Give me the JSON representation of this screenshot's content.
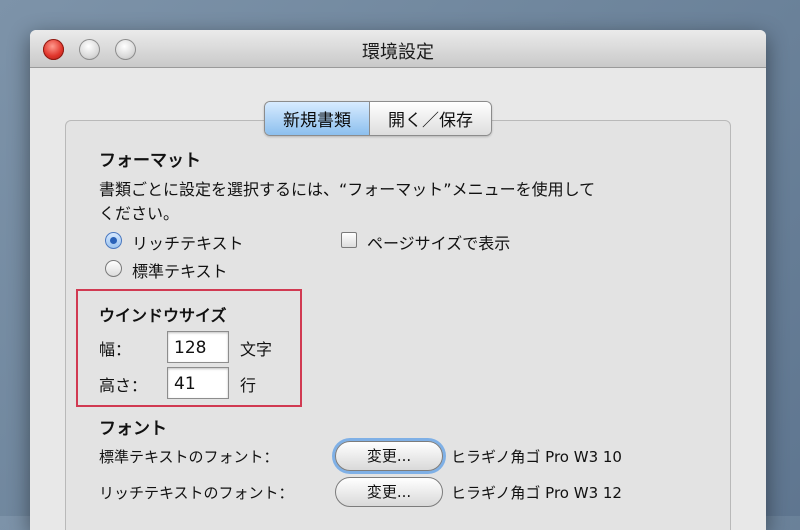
{
  "window": {
    "title": "環境設定"
  },
  "tabs": [
    {
      "label": "新規書類",
      "active": true
    },
    {
      "label": "開く／保存",
      "active": false
    }
  ],
  "format": {
    "heading": "フォーマット",
    "description_line1": "書類ごとに設定を選択するには、“フォーマット”メニューを使用して",
    "description_line2": "ください。",
    "rich_text_label": "リッチテキスト",
    "plain_text_label": "標準テキスト",
    "selected": "リッチテキスト",
    "show_page_size_label": "ページサイズで表示",
    "show_page_size_checked": false
  },
  "window_size": {
    "heading": "ウインドウサイズ",
    "width_label": "幅：",
    "width_value": "128",
    "width_unit": "文字",
    "height_label": "高さ：",
    "height_value": "41",
    "height_unit": "行"
  },
  "font": {
    "heading": "フォント",
    "plain_label": "標準テキストのフォント：",
    "plain_button": "変更...",
    "plain_value": "ヒラギノ角ゴ Pro W3 10",
    "rich_label": "リッチテキストのフォント：",
    "rich_button": "変更...",
    "rich_value": "ヒラギノ角ゴ Pro W3 12"
  },
  "colors": {
    "highlight_box": "#d13a52",
    "active_tab": "#8cbfee",
    "close_button": "#e0352b"
  },
  "icons": [
    "close-icon",
    "minimize-icon",
    "zoom-icon",
    "radio-icon",
    "checkbox-icon"
  ]
}
